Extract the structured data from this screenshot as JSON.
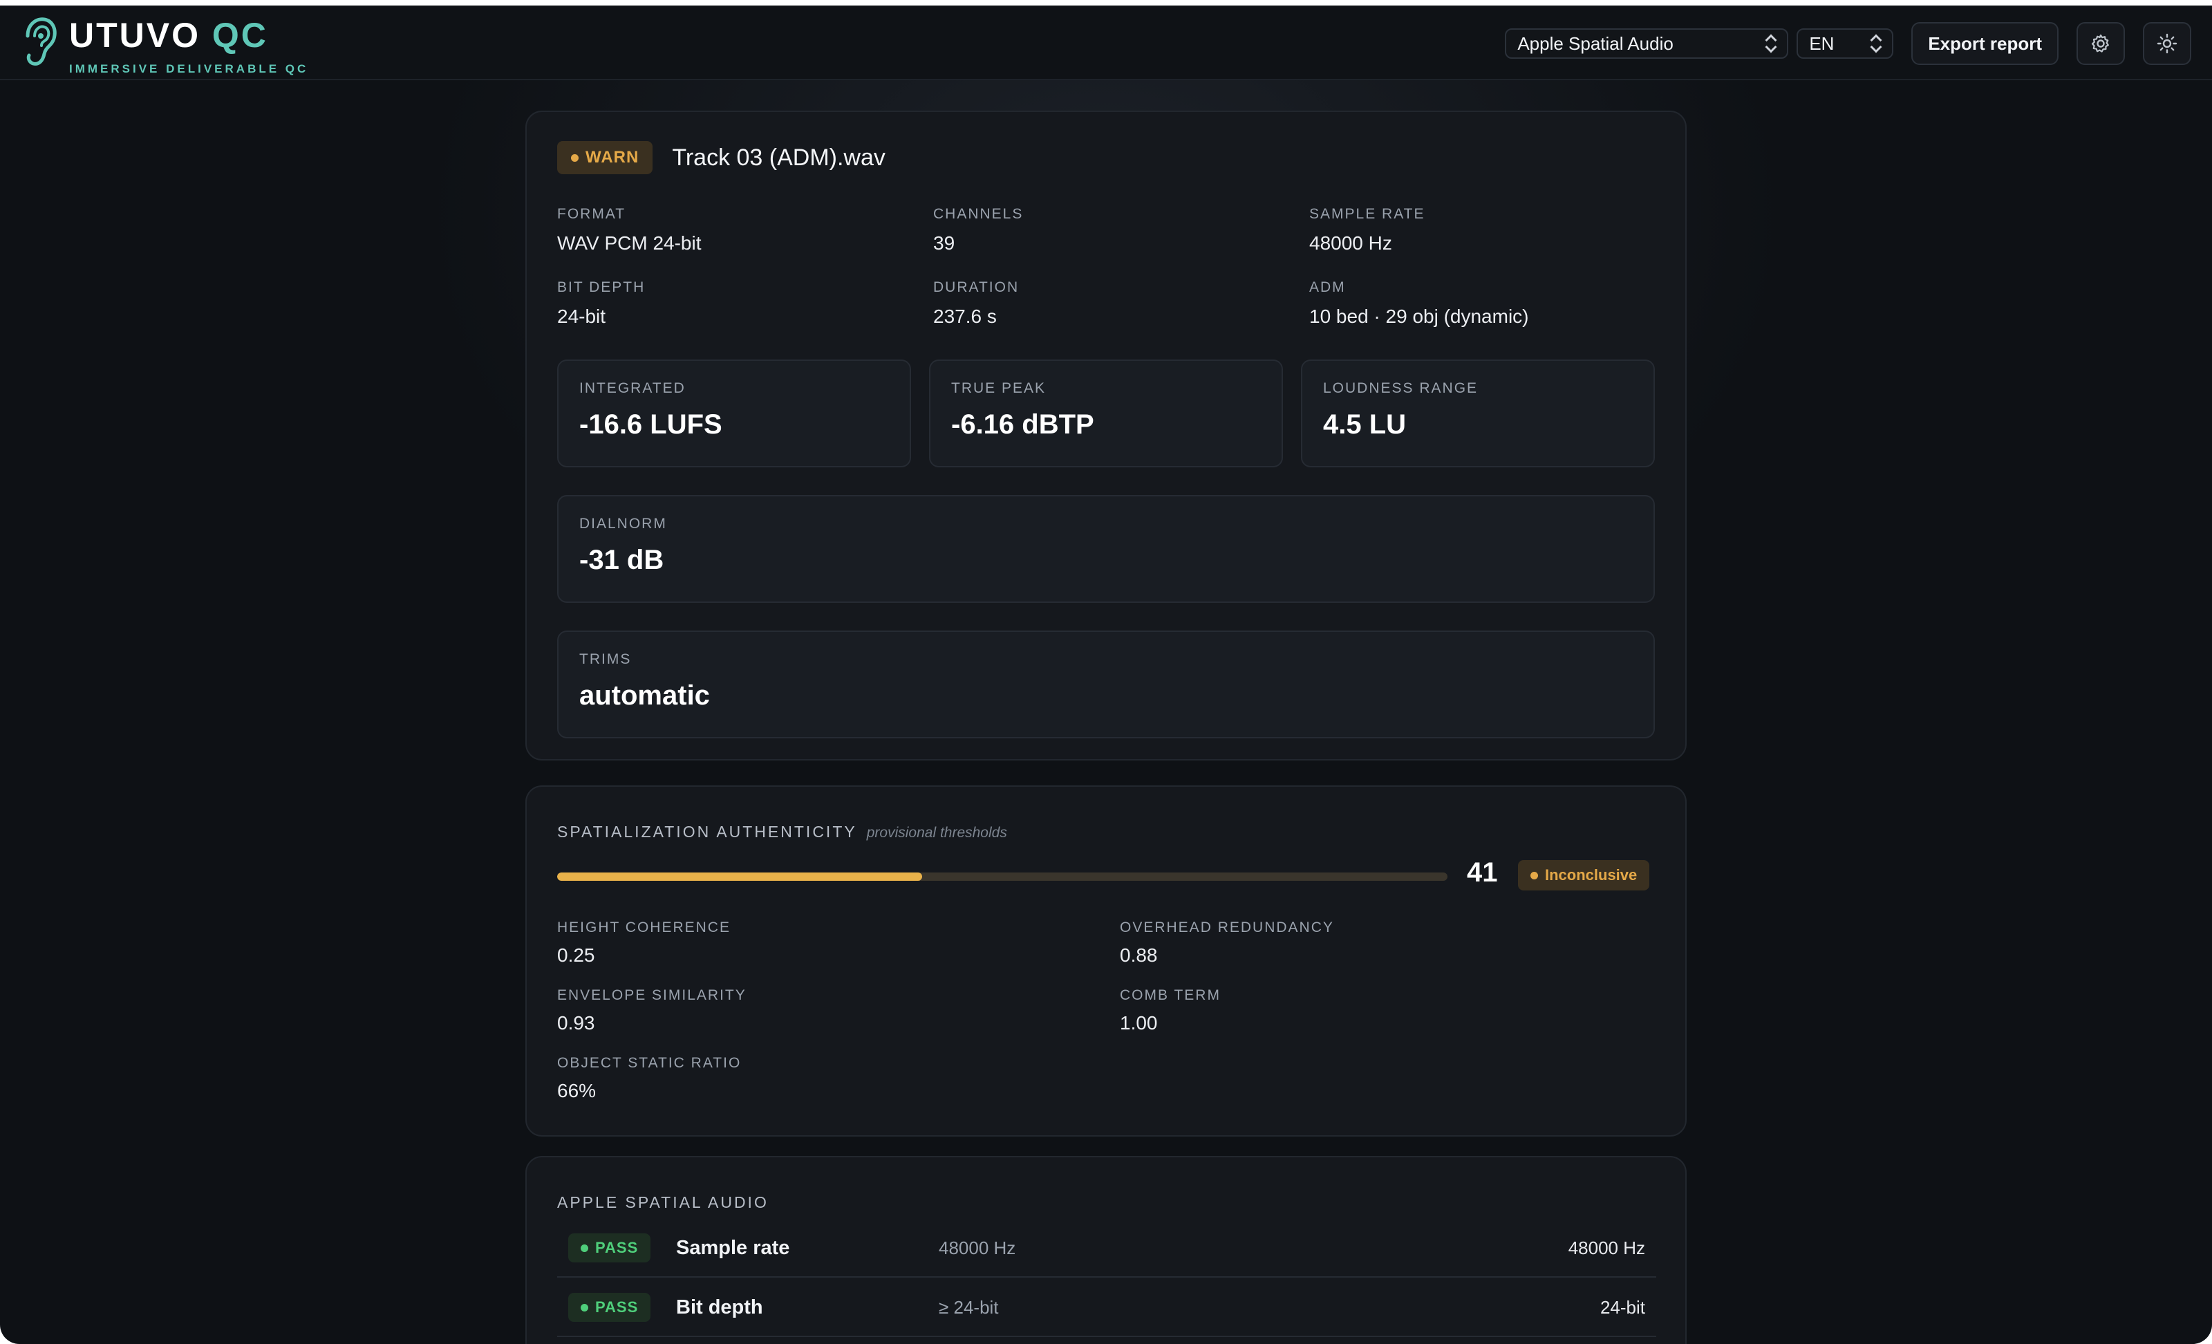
{
  "brand": {
    "name_main": "UTUVO",
    "name_accent": "QC",
    "tagline": "IMMERSIVE DELIVERABLE QC"
  },
  "header": {
    "profile_select": "Apple Spatial Audio",
    "language_select": "EN",
    "export_label": "Export report",
    "settings_icon": "gear-icon",
    "theme_icon": "sun-icon"
  },
  "file": {
    "status": "WARN",
    "name": "Track 03 (ADM).wav",
    "meta": [
      {
        "label": "FORMAT",
        "value": "WAV PCM 24-bit"
      },
      {
        "label": "CHANNELS",
        "value": "39"
      },
      {
        "label": "SAMPLE RATE",
        "value": "48000 Hz"
      },
      {
        "label": "BIT DEPTH",
        "value": "24-bit"
      },
      {
        "label": "DURATION",
        "value": "237.6 s"
      },
      {
        "label": "ADM",
        "value": "10 bed · 29 obj (dynamic)"
      }
    ],
    "loudness": [
      {
        "label": "INTEGRATED",
        "value": "-16.6 LUFS"
      },
      {
        "label": "TRUE PEAK",
        "value": "-6.16 dBTP"
      },
      {
        "label": "LOUDNESS RANGE",
        "value": "4.5 LU"
      }
    ],
    "dialnorm": {
      "label": "DIALNORM",
      "value": "-31 dB"
    },
    "trims": {
      "label": "TRIMS",
      "value": "automatic"
    }
  },
  "spatialization": {
    "title": "SPATIALIZATION AUTHENTICITY",
    "note": "provisional thresholds",
    "score": "41",
    "score_fraction": 0.41,
    "verdict": "Inconclusive",
    "colors": {
      "bar_fill": "#e9b24a",
      "bar_track": "#3a352c"
    },
    "metrics": [
      {
        "label": "HEIGHT COHERENCE",
        "value": "0.25"
      },
      {
        "label": "OVERHEAD REDUNDANCY",
        "value": "0.88"
      },
      {
        "label": "ENVELOPE SIMILARITY",
        "value": "0.93"
      },
      {
        "label": "COMB TERM",
        "value": "1.00"
      },
      {
        "label": "OBJECT STATIC RATIO",
        "value": "66%"
      }
    ]
  },
  "profile_checks": {
    "title": "APPLE SPATIAL AUDIO",
    "rows": [
      {
        "status": "PASS",
        "name": "Sample rate",
        "requirement": "48000 Hz",
        "value": "48000 Hz"
      },
      {
        "status": "PASS",
        "name": "Bit depth",
        "requirement": "≥ 24-bit",
        "value": "24-bit"
      }
    ]
  },
  "colors": {
    "accent": "#5fc7b7",
    "warn": "#e5a948",
    "pass": "#4fcf7b",
    "background": "#0e1115"
  }
}
